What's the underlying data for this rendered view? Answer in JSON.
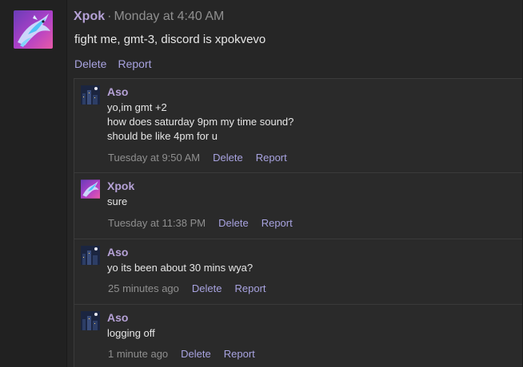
{
  "post": {
    "author": "Xpok",
    "separator": "·",
    "timestamp": "Monday at 4:40 AM",
    "body": "fight me, gmt-3, discord is xpokvevo",
    "actions": {
      "delete": "Delete",
      "report": "Report"
    }
  },
  "replies": [
    {
      "author": "Aso",
      "lines": [
        "yo,im gmt +2",
        "how does saturday 9pm my time sound?",
        "should be like 4pm for u"
      ],
      "timestamp": "Tuesday at 9:50 AM",
      "delete": "Delete",
      "report": "Report"
    },
    {
      "author": "Xpok",
      "lines": [
        "sure"
      ],
      "timestamp": "Tuesday at 11:38 PM",
      "delete": "Delete",
      "report": "Report"
    },
    {
      "author": "Aso",
      "lines": [
        "yo its been about 30 mins wya?"
      ],
      "timestamp": "25 minutes ago",
      "delete": "Delete",
      "report": "Report"
    },
    {
      "author": "Aso",
      "lines": [
        "logging off"
      ],
      "timestamp": "1 minute ago",
      "delete": "Delete",
      "report": "Report"
    }
  ],
  "colors": {
    "background": "#262626",
    "author": "#b5a1d6",
    "link": "#a8a3e0",
    "muted": "#8f8f8f",
    "text": "#e6e6e6"
  }
}
